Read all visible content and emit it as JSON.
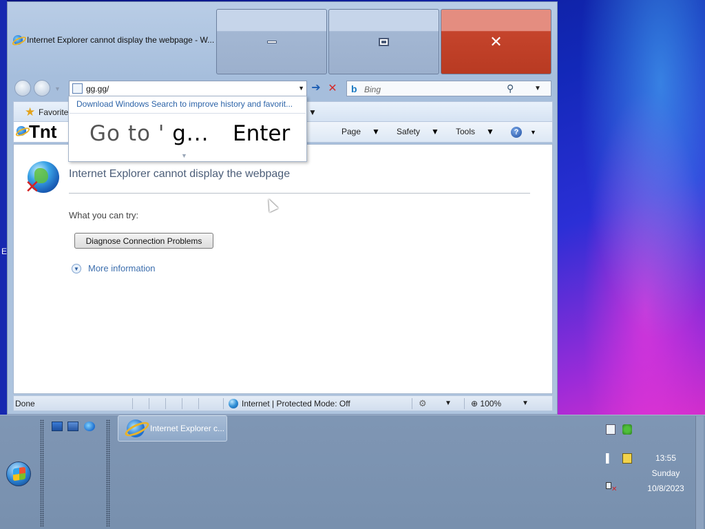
{
  "window": {
    "title": "Internet Explorer cannot display the webpage - W...",
    "close_glyph": "✕"
  },
  "nav": {
    "address": "gg.gg/",
    "search_placeholder": "Bing",
    "search_logo": "b"
  },
  "autocomplete": {
    "suggestion": "Download Windows Search to improve history and favorit...",
    "go_to_prefix": "Go to '",
    "go_to_value": "g...",
    "enter_hint": "Enter"
  },
  "favorites_bar": {
    "label": "Favorite"
  },
  "command_bar": {
    "tab_fragment": "Tnt",
    "page": "Page",
    "safety": "Safety",
    "tools": "Tools",
    "help": "?"
  },
  "content": {
    "title": "Internet Explorer cannot display the webpage",
    "try_text": "What you can try:",
    "diagnose_button": "Diagnose Connection Problems",
    "more_info": "More information"
  },
  "status_bar": {
    "status": "Done",
    "zone": "Internet | Protected Mode: Off",
    "zoom": "100%"
  },
  "desktop": {
    "edge_letter": "E"
  },
  "taskbar": {
    "task_label": "Internet Explorer c...",
    "clock_time": "13:55",
    "clock_day": "Sunday",
    "clock_date": "10/8/2023"
  },
  "icons": {
    "ie": "ie-logo-icon",
    "favorites": "star-icon",
    "search": "magnifier-icon",
    "go": "arrow-right-icon",
    "stop": "stop-x-icon",
    "error": "globe-error-icon",
    "zone": "internet-globe-icon",
    "zoom": "zoom-magnifier-icon",
    "help": "help-icon"
  },
  "colors": {
    "close_red": "#c5442c",
    "link_blue": "#2d64a8",
    "title_gray_blue": "#4b5d78"
  }
}
